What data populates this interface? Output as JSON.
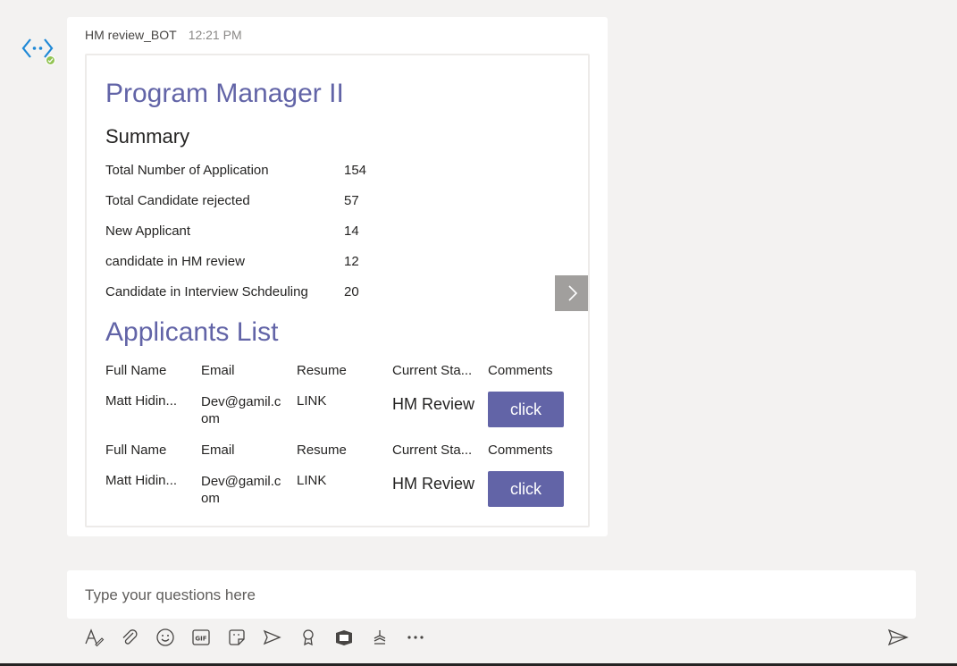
{
  "message": {
    "sender": "HM review_BOT",
    "time": "12:21 PM"
  },
  "card": {
    "title": "Program Manager II",
    "summary_title": "Summary",
    "facts": [
      {
        "label": "Total Number of Application",
        "value": "154"
      },
      {
        "label": "Total Candidate rejected",
        "value": "57"
      },
      {
        "label": "New Applicant",
        "value": "14"
      },
      {
        "label": "candidate in HM review",
        "value": "12"
      },
      {
        "label": "Candidate in Interview Schdeuling",
        "value": "20"
      }
    ],
    "list_title": "Applicants List",
    "rows": [
      {
        "headers": {
          "name": "Full Name",
          "email": "Email",
          "resume": "Resume",
          "status": "Current Sta...",
          "comments": "Comments"
        },
        "name": "Matt Hidin...",
        "email": "Dev@gamil.com",
        "resume": "LINK",
        "status": "HM Review",
        "button": "click"
      },
      {
        "headers": {
          "name": "Full Name",
          "email": "Email",
          "resume": "Resume",
          "status": "Current Sta...",
          "comments": "Comments"
        },
        "name": "Matt Hidin...",
        "email": "Dev@gamil.com",
        "resume": "LINK",
        "status": "HM Review",
        "button": "click"
      }
    ]
  },
  "compose": {
    "placeholder": "Type your questions here"
  },
  "colors": {
    "accent": "#6264a7",
    "background": "#f3f2f1",
    "status_online": "#92c353"
  },
  "toolbar_icons": [
    "format-icon",
    "attach-icon",
    "emoji-icon",
    "gif-icon",
    "sticker-icon",
    "meet-icon",
    "praise-icon",
    "app-icon",
    "stream-icon",
    "more-icon",
    "send-icon"
  ]
}
